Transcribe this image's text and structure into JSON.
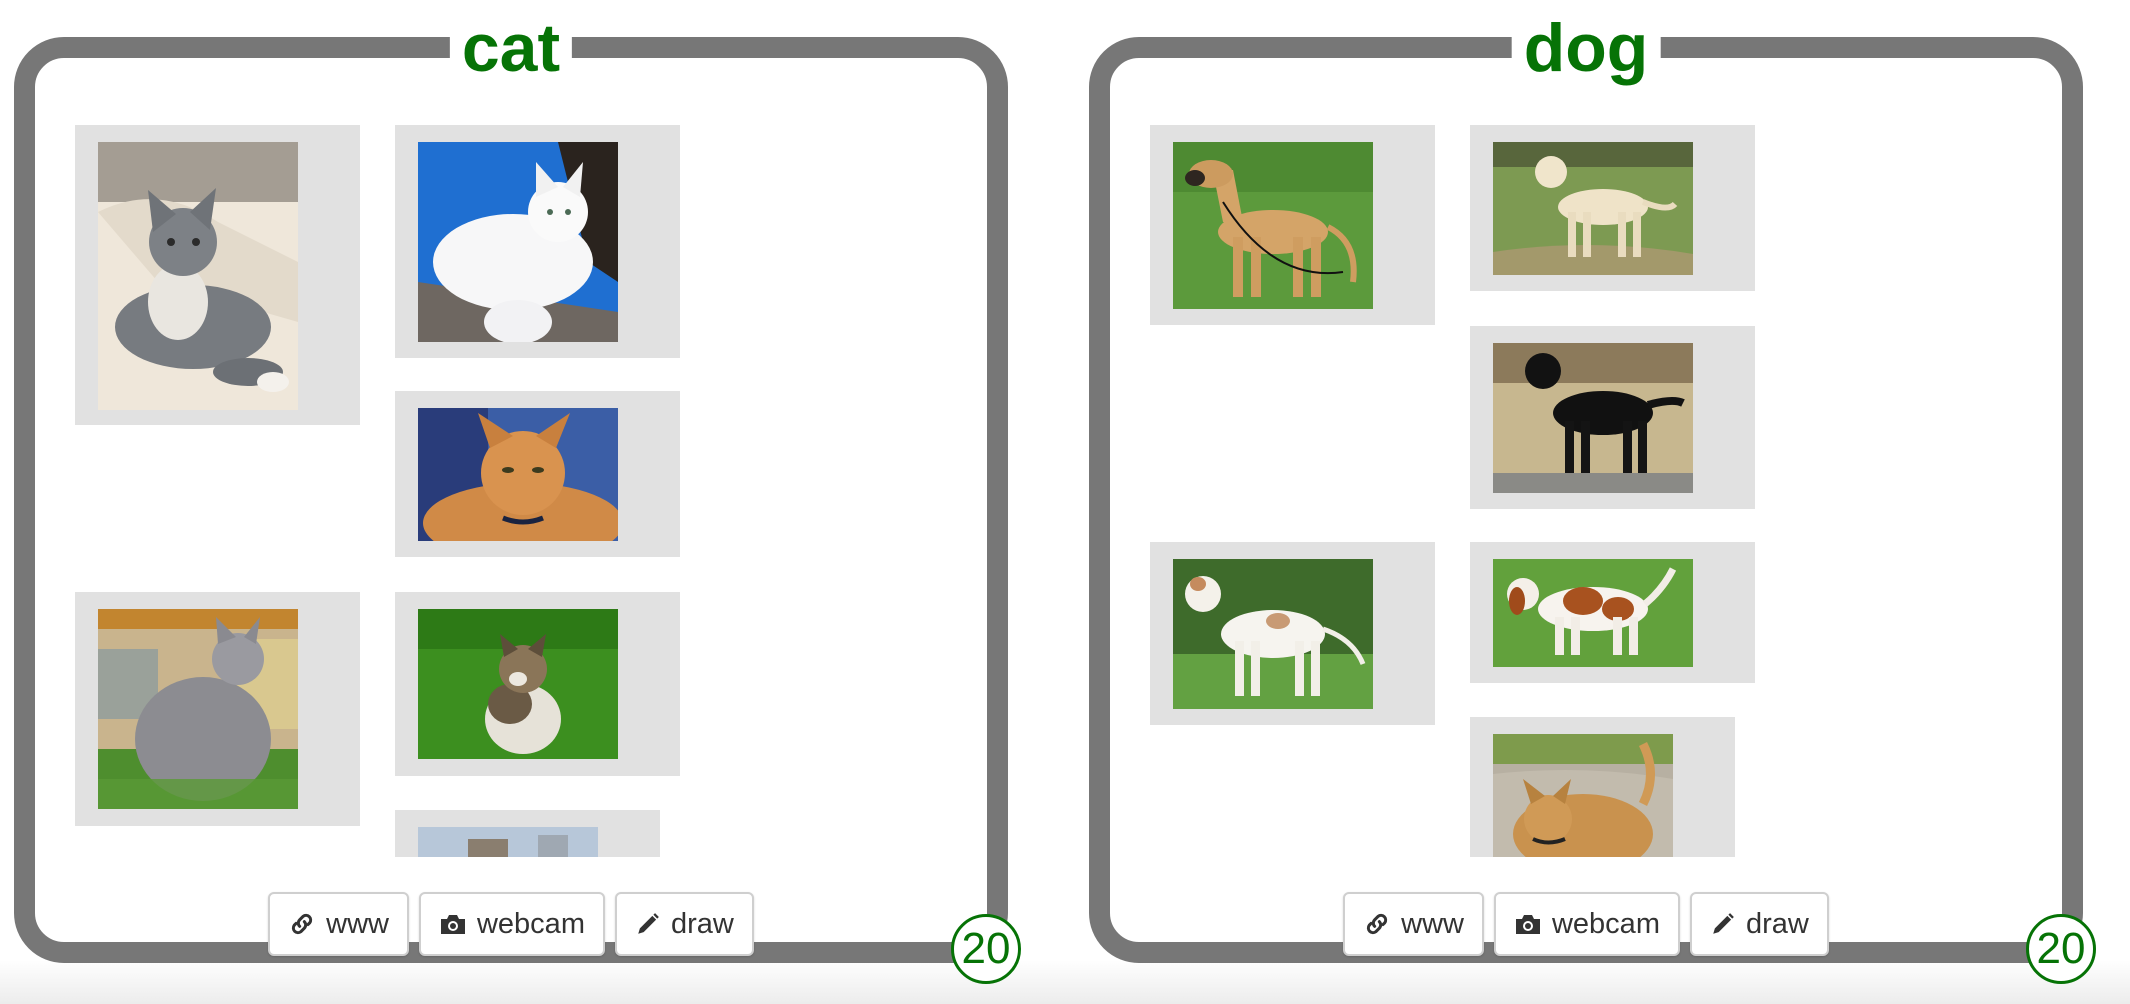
{
  "panels": [
    {
      "title": "cat",
      "count": "20",
      "buttons": {
        "www": "www",
        "webcam": "webcam",
        "draw": "draw"
      },
      "images": [
        "cat-gray-on-bed",
        "cat-white-fluffy",
        "cat-orange-tabby",
        "cat-gray-long-hair-grass",
        "cat-calico-grass",
        "cat-partial"
      ]
    },
    {
      "title": "dog",
      "count": "20",
      "buttons": {
        "www": "www",
        "webcam": "webcam",
        "draw": "draw"
      },
      "images": [
        "dog-great-dane-fawn",
        "dog-yellow-labrador",
        "dog-black-flat-coated-retriever",
        "dog-white-pointer",
        "dog-welsh-springer-spaniel",
        "dog-tan-mixed-breed"
      ]
    }
  ],
  "icons": {
    "www": "link-icon",
    "webcam": "camera-icon",
    "draw": "pencil-icon"
  },
  "colors": {
    "title": "#067306",
    "frame": "#777777",
    "tile": "#e1e1e1",
    "badge": "#067306"
  }
}
